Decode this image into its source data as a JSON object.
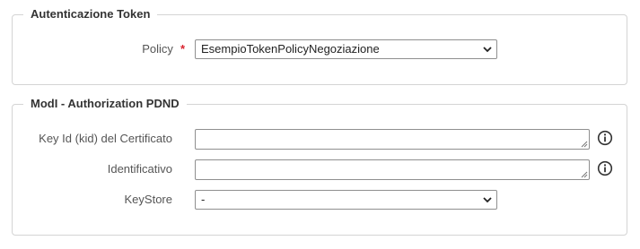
{
  "section_token": {
    "legend": "Autenticazione Token",
    "policy_label": "Policy",
    "required_mark": "*",
    "policy_value": "EsempioTokenPolicyNegoziazione"
  },
  "section_pdnd": {
    "legend": "ModI - Authorization PDND",
    "kid_label": "Key Id (kid) del Certificato",
    "kid_value": "",
    "id_label": "Identificativo",
    "id_value": "",
    "keystore_label": "KeyStore",
    "keystore_value": "-"
  },
  "icons": [
    "chevron-down-icon",
    "info-icon",
    "resize-grip-icon"
  ]
}
